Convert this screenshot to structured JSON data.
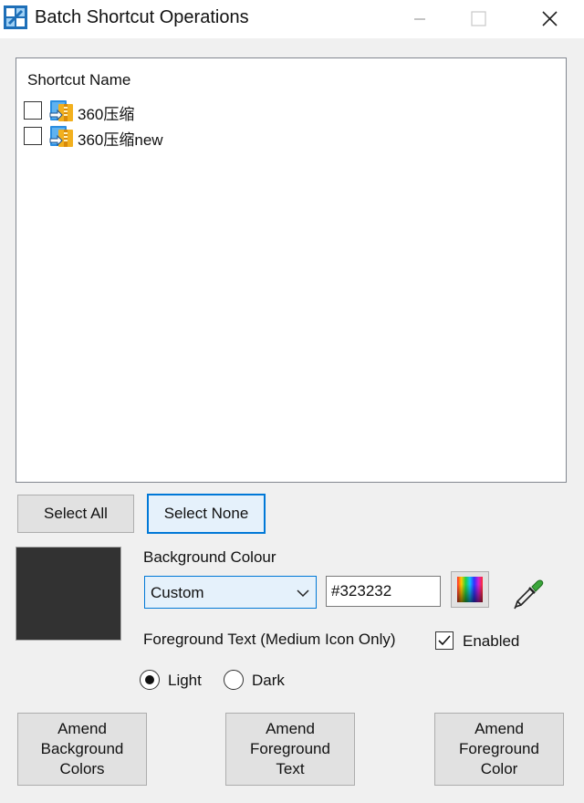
{
  "window": {
    "title": "Batch Shortcut Operations"
  },
  "list": {
    "header": "Shortcut Name",
    "items": [
      {
        "label": "360压缩",
        "checked": false
      },
      {
        "label": "360压缩new",
        "checked": false
      }
    ]
  },
  "selection": {
    "select_all": "Select All",
    "select_none": "Select None"
  },
  "background": {
    "label": "Background Colour",
    "preset": "Custom",
    "hex": "#323232",
    "swatch_color": "#323232"
  },
  "foreground": {
    "label": "Foreground Text (Medium Icon Only)",
    "enabled_label": "Enabled",
    "enabled": true,
    "light_label": "Light",
    "dark_label": "Dark",
    "selected": "Light"
  },
  "actions": {
    "amend_bg": [
      "Amend",
      "Background",
      "Colors"
    ],
    "amend_fg_text": [
      "Amend",
      "Foreground",
      "Text"
    ],
    "amend_fg_color": [
      "Amend",
      "Foreground",
      "Color"
    ]
  },
  "icons": {
    "app": "app-icon",
    "minimize": "minimize-icon",
    "maximize": "maximize-icon",
    "close": "close-icon",
    "shortcut": "archive-icon",
    "dropdown": "chevron-down-icon",
    "color_picker": "color-spectrum-icon",
    "eyedropper": "eyedropper-icon"
  }
}
